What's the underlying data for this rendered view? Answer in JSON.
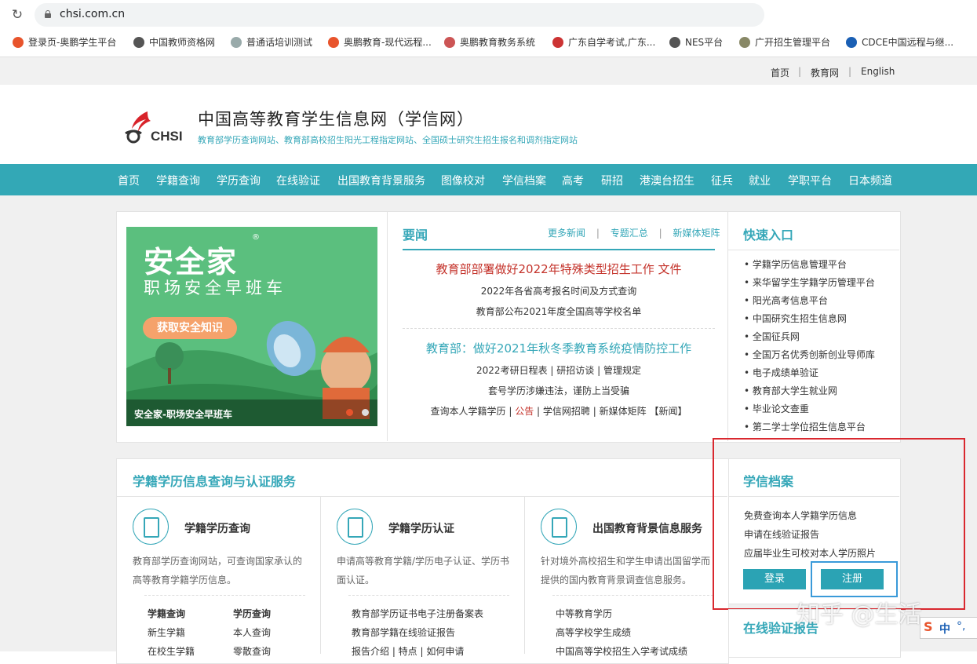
{
  "browser": {
    "url": "chsi.com.cn",
    "bookmarks": [
      "登录页-奥鹏学生平台",
      "中国教师资格网",
      "普通话培训测试",
      "奥鹏教育-现代远程...",
      "奥鹏教育教务系统",
      "广东自学考试,广东...",
      "NES平台",
      "广开招生管理平台",
      "CDCE中国远程与继..."
    ]
  },
  "topbar": {
    "links": [
      "首页",
      "教育网",
      "English"
    ]
  },
  "header": {
    "logo_text": "CHSI",
    "title": "中国高等教育学生信息网（学信网）",
    "subtitle": "教育部学历查询网站、教育部高校招生阳光工程指定网站、全国硕士研究生招生报名和调剂指定网站"
  },
  "nav": [
    "首页",
    "学籍查询",
    "学历查询",
    "在线验证",
    "出国教育背景服务",
    "图像校对",
    "学信档案",
    "高考",
    "研招",
    "港澳台招生",
    "征兵",
    "就业",
    "学职平台",
    "日本频道"
  ],
  "banner": {
    "title": "安全家",
    "subtitle": "职场安全早班车",
    "button": "获取安全知识",
    "caption": "安全家-职场安全早班车"
  },
  "news": {
    "title": "要闻",
    "links": [
      "更多新闻",
      "专题汇总",
      "新媒体矩阵"
    ],
    "headline1": "教育部部署做好2022年特殊类型招生工作 文件",
    "item1": "2022年各省高考报名时间及方式查询",
    "item2": "教育部公布2021年度全国高等学校名单",
    "headline2": "教育部：做好2021年秋冬季教育系统疫情防控工作",
    "row1": [
      "2022考研日程表",
      "研招访谈",
      "管理规定"
    ],
    "item3": "套号学历涉嫌违法，谨防上当受骗",
    "row2": [
      "查询本人学籍学历",
      "公告",
      "学信网招聘",
      "新媒体矩阵",
      "【新闻】"
    ]
  },
  "quick": {
    "title": "快速入口",
    "items": [
      "学籍学历信息管理平台",
      "来华留学生学籍学历管理平台",
      "阳光高考信息平台",
      "中国研究生招生信息网",
      "全国征兵网",
      "全国万名优秀创新创业导师库",
      "电子成绩单验证",
      "教育部大学生就业网",
      "毕业论文查重",
      "第二学士学位招生信息平台"
    ]
  },
  "service": {
    "title": "学籍学历信息查询与认证服务",
    "col1": {
      "title": "学籍学历查询",
      "desc": "教育部学历查询网站，可查询国家承认的高等教育学籍学历信息。",
      "links": [
        "学籍查询",
        "学历查询",
        "新生学籍",
        "本人查询",
        "在校生学籍",
        "零散查询"
      ]
    },
    "col2": {
      "title": "学籍学历认证",
      "desc": "申请高等教育学籍/学历电子认证、学历书面认证。",
      "links": [
        "教育部学历证书电子注册备案表",
        "教育部学籍在线验证报告",
        "报告介绍 | 特点 | 如何申请"
      ]
    },
    "col3": {
      "title": "出国教育背景信息服务",
      "desc": "针对境外高校招生和学生申请出国留学而提供的国内教育背景调查信息服务。",
      "links": [
        "中等教育学历",
        "高等学校学生成绩",
        "中国高等学校招生入学考试成绩"
      ]
    }
  },
  "archive": {
    "title": "学信档案",
    "items": [
      "免费查询本人学籍学历信息",
      "申请在线验证报告",
      "应届毕业生可校对本人学历照片"
    ],
    "login": "登录",
    "register": "注册"
  },
  "verify": {
    "title": "在线验证报告"
  },
  "watermark": "知乎 @生活",
  "ime": "中"
}
